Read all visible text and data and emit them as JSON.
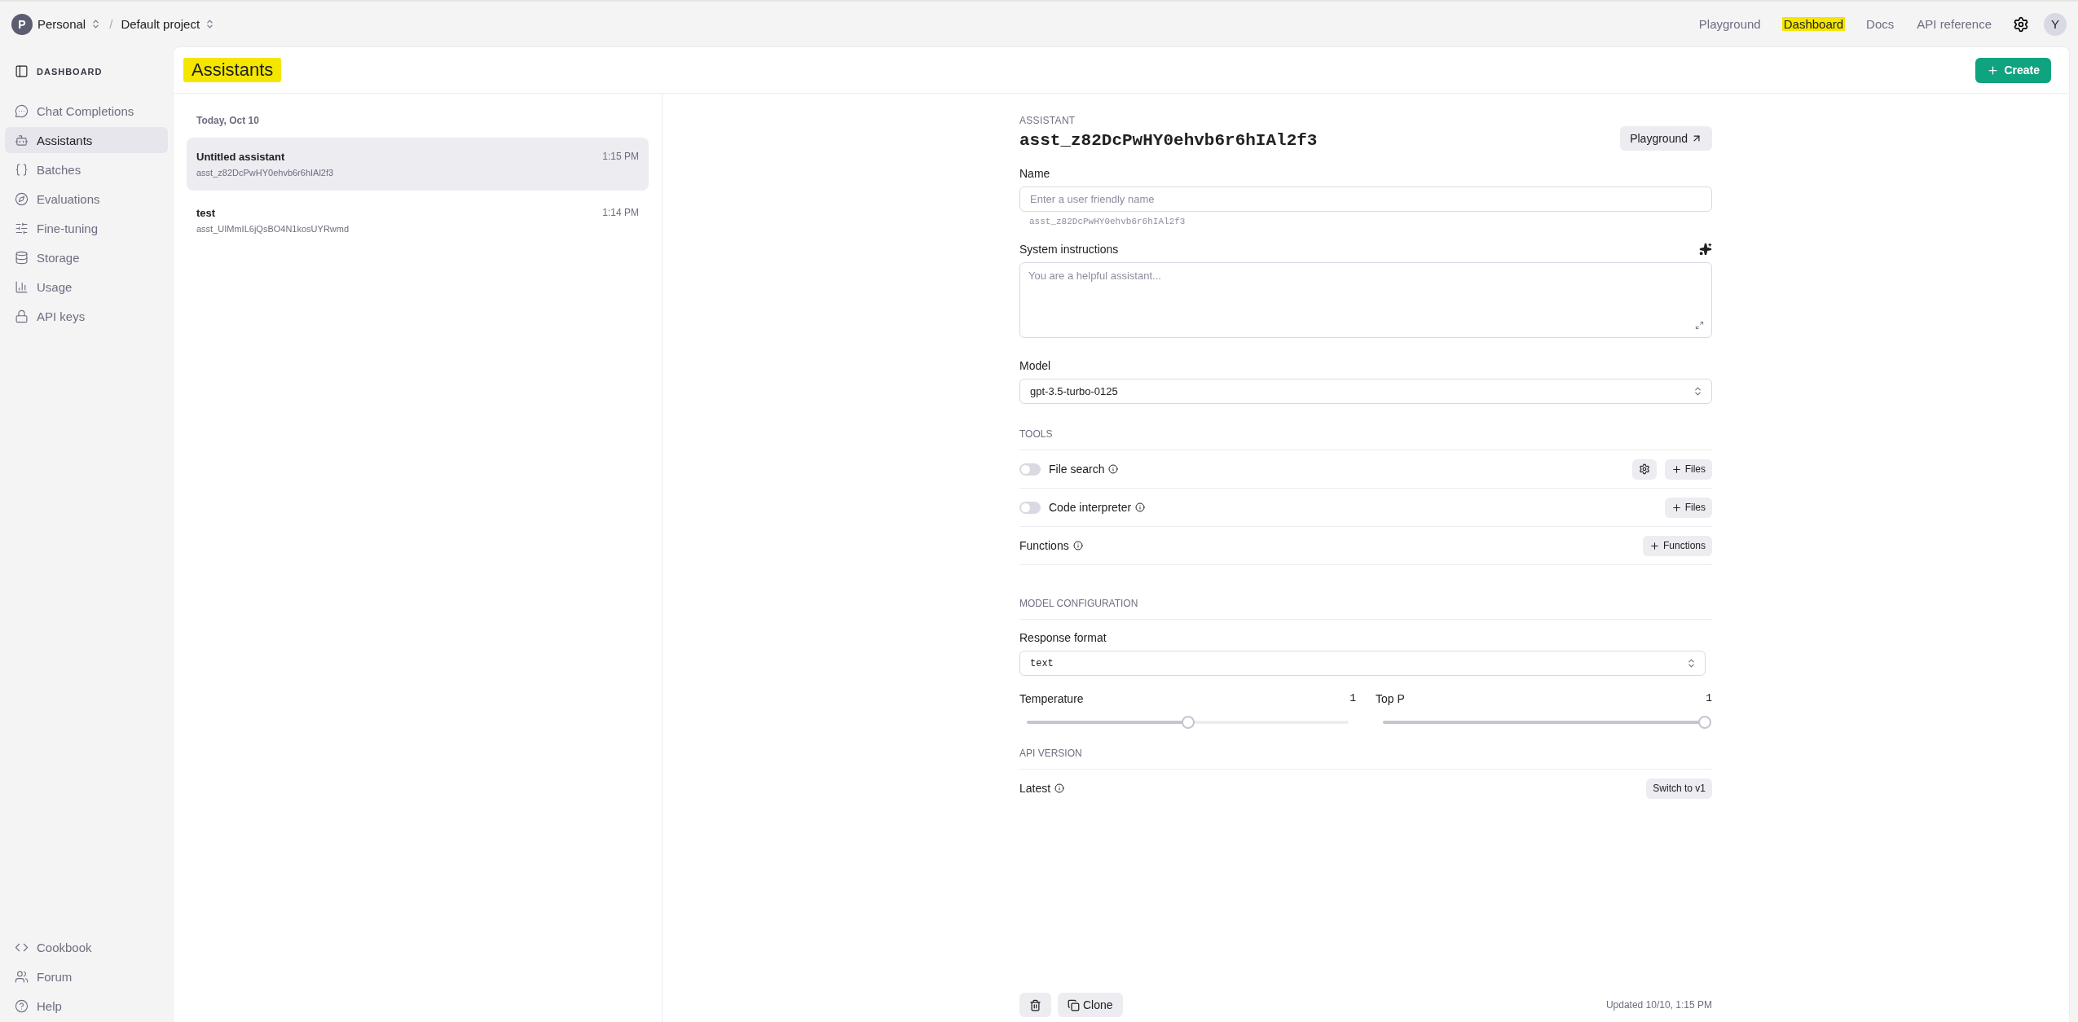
{
  "top_bar": {
    "org_avatar": "P",
    "org": "Personal",
    "separator": "/",
    "project": "Default project",
    "nav": [
      {
        "label": "Playground",
        "highlighted": false
      },
      {
        "label": "Dashboard",
        "highlighted": true
      },
      {
        "label": "Docs",
        "highlighted": false
      },
      {
        "label": "API reference",
        "highlighted": false
      }
    ],
    "user_avatar": "Y"
  },
  "sidebar": {
    "title": "DASHBOARD",
    "items": [
      {
        "kind": "chat",
        "label": "Chat Completions",
        "selected": false
      },
      {
        "kind": "bot",
        "label": "Assistants",
        "selected": true
      },
      {
        "kind": "braces",
        "label": "Batches",
        "selected": false
      },
      {
        "kind": "compass",
        "label": "Evaluations",
        "selected": false
      },
      {
        "kind": "sliders",
        "label": "Fine-tuning",
        "selected": false
      },
      {
        "kind": "database",
        "label": "Storage",
        "selected": false
      },
      {
        "kind": "chart",
        "label": "Usage",
        "selected": false
      },
      {
        "kind": "lock",
        "label": "API keys",
        "selected": false
      }
    ],
    "footer_items": [
      {
        "kind": "code",
        "label": "Cookbook"
      },
      {
        "kind": "users",
        "label": "Forum"
      },
      {
        "kind": "help",
        "label": "Help"
      }
    ]
  },
  "page": {
    "title": "Assistants",
    "title_highlighted": true,
    "create_button": "Create"
  },
  "assistant_list": {
    "group_label": "Today, Oct 10",
    "items": [
      {
        "name": "Untitled assistant",
        "id": "asst_z82DcPwHY0ehvb6r6hIAl2f3",
        "time": "1:15 PM",
        "selected": true
      },
      {
        "name": "test",
        "id": "asst_UIMmIL6jQsBO4N1kosUYRwmd",
        "time": "1:14 PM",
        "selected": false
      }
    ]
  },
  "assistant": {
    "section_label": "ASSISTANT",
    "id": "asst_z82DcPwHY0ehvb6r6hIAl2f3",
    "playground_button": "Playground",
    "name_label": "Name",
    "name_placeholder": "Enter a user friendly name",
    "name_hint": "asst_z82DcPwHY0ehvb6r6hIAl2f3",
    "instructions_label": "System instructions",
    "instructions_placeholder": "You are a helpful assistant...",
    "model_label": "Model",
    "model_value": "gpt-3.5-turbo-0125",
    "tools_label": "TOOLS",
    "tools": [
      {
        "kind": "toggle",
        "label": "File search",
        "on": false,
        "buttons": [
          {
            "kind": "settings"
          },
          {
            "kind": "add",
            "label": "Files"
          }
        ]
      },
      {
        "kind": "toggle",
        "label": "Code interpreter",
        "on": false,
        "buttons": [
          {
            "kind": "add",
            "label": "Files"
          }
        ]
      },
      {
        "kind": "plain",
        "label": "Functions",
        "buttons": [
          {
            "kind": "add",
            "label": "Functions"
          }
        ]
      }
    ],
    "config_label": "MODEL CONFIGURATION",
    "response_format_label": "Response format",
    "response_format_value": "text",
    "sliders": [
      {
        "label": "Temperature",
        "reading": "1",
        "level": 0.5
      },
      {
        "label": "Top P",
        "reading": "1",
        "level": 1
      }
    ],
    "api_label": "API VERSION",
    "api_version": "Latest",
    "switch_button": "Switch to v1",
    "clone_button": "Clone",
    "updated": "Updated 10/10, 1:15 PM"
  }
}
